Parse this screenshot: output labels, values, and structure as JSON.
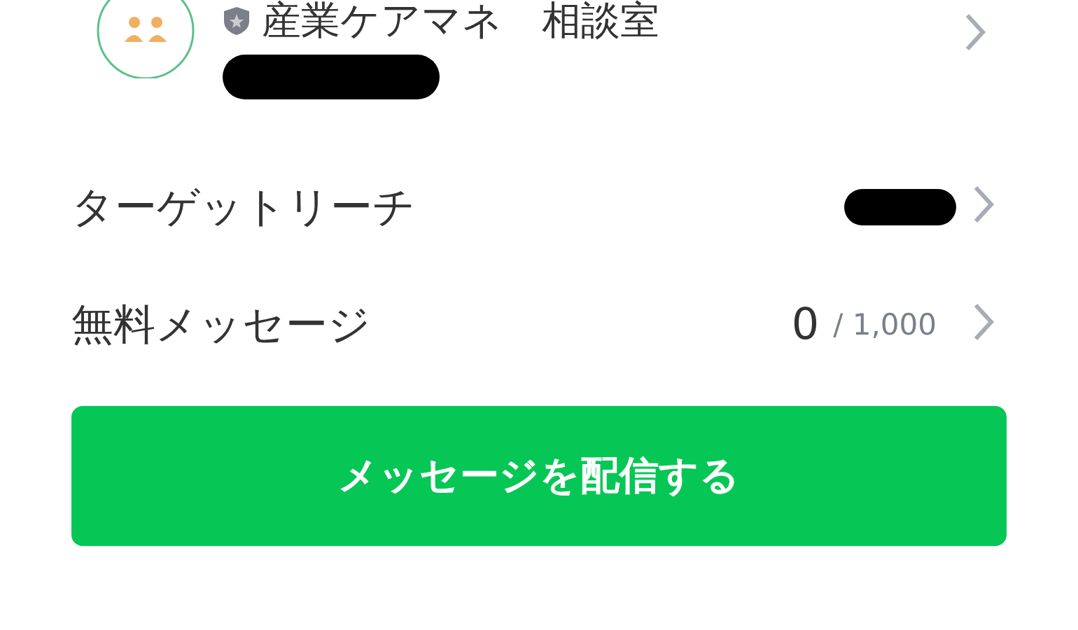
{
  "account": {
    "name": "産業ケアマネ　相談室"
  },
  "rows": [
    {
      "label": "ターゲットリーチ",
      "value_redacted": true
    },
    {
      "label": "無料メッセージ",
      "value": "0",
      "limit": "/ 1,000"
    }
  ],
  "button": {
    "label": "メッセージを配信する"
  }
}
